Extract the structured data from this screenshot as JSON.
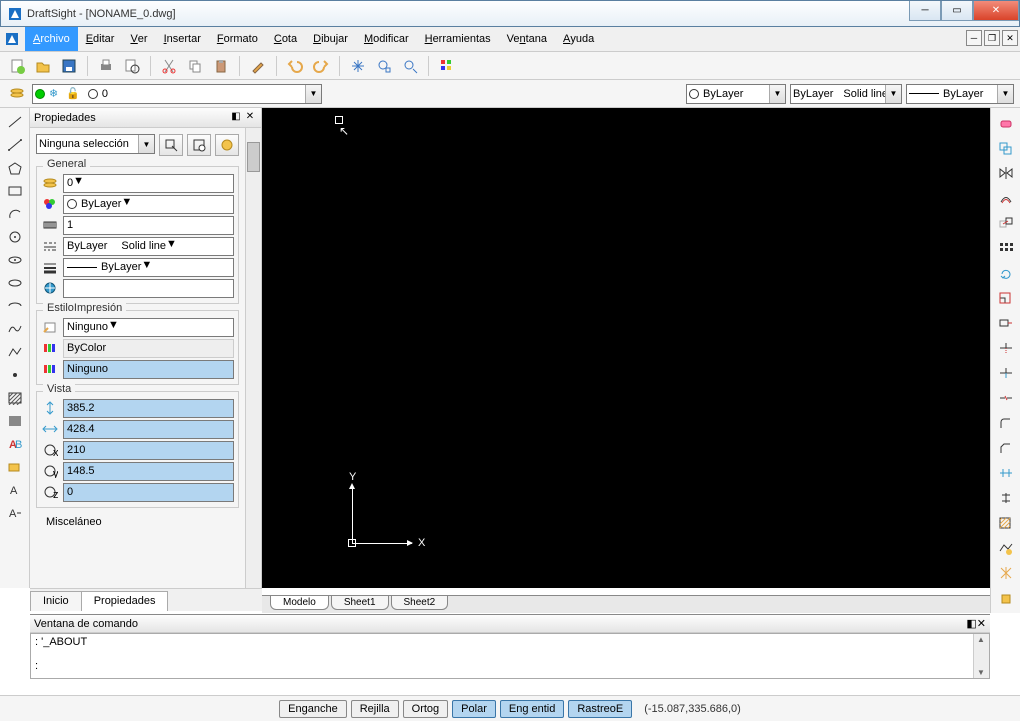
{
  "window": {
    "title": "DraftSight - [NONAME_0.dwg]"
  },
  "menu": {
    "items": [
      "Archivo",
      "Editar",
      "Ver",
      "Insertar",
      "Formato",
      "Cota",
      "Dibujar",
      "Modificar",
      "Herramientas",
      "Ventana",
      "Ayuda"
    ],
    "active_index": 0
  },
  "layerbar": {
    "current_layer": "0",
    "color": "ByLayer",
    "linetype_left": "ByLayer",
    "linetype_right": "Solid line",
    "lineweight": "ByLayer"
  },
  "properties": {
    "panel_title": "Propiedades",
    "selection": "Ninguna selección",
    "sections": {
      "general_title": "General",
      "general": {
        "layer": "0",
        "color": "ByLayer",
        "scale": "1",
        "linetype_a": "ByLayer",
        "linetype_b": "Solid line",
        "lineweight": "ByLayer",
        "hyperlink": ""
      },
      "print_title": "EstiloImpresión",
      "print": {
        "style": "Ninguno",
        "table": "ByColor",
        "attached": "Ninguno"
      },
      "view_title": "Vista",
      "view": {
        "v1": "385.2",
        "v2": "428.4",
        "v3": "210",
        "v4": "148.5",
        "v5": "0"
      },
      "misc_title": "Misceláneo"
    },
    "tabs": {
      "home": "Inicio",
      "props": "Propiedades",
      "active": "props"
    }
  },
  "model_tabs": {
    "items": [
      "Modelo",
      "Sheet1",
      "Sheet2"
    ],
    "active_index": 0
  },
  "command": {
    "title": "Ventana de comando",
    "line1": ": '_ABOUT",
    "prompt": ":"
  },
  "status": {
    "buttons": [
      {
        "label": "Enganche",
        "active": false
      },
      {
        "label": "Rejilla",
        "active": false
      },
      {
        "label": "Ortog",
        "active": false
      },
      {
        "label": "Polar",
        "active": true
      },
      {
        "label": "Eng entid",
        "active": true
      },
      {
        "label": "RastreoE",
        "active": true
      }
    ],
    "coords": "(-15.087,335.686,0)"
  },
  "ucs": {
    "x": "X",
    "y": "Y"
  }
}
